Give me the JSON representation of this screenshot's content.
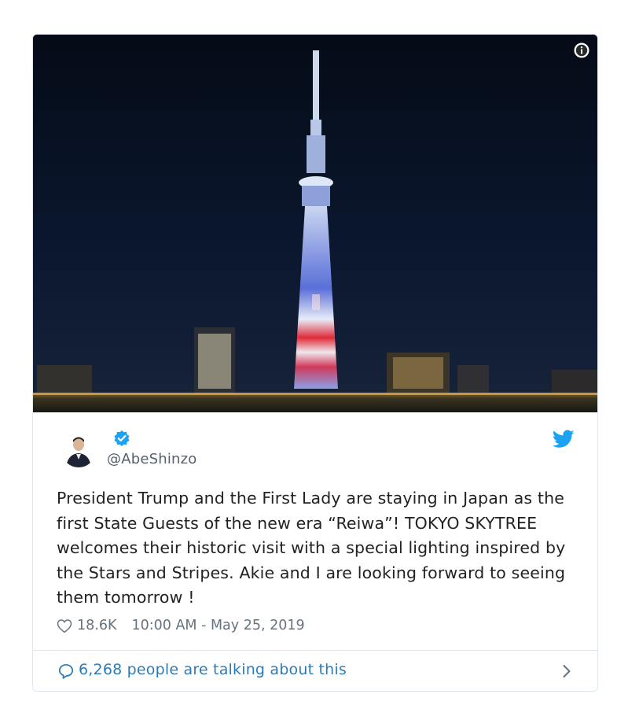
{
  "tweet": {
    "handle": "@AbeShinzo",
    "text": "President Trump and the First Lady are staying in Japan as the first State Guests of the new era “Reiwa”! TOKYO SKYTREE welcomes their historic visit with a special lighting inspired by the Stars and Stripes. Akie and I are looking forward to seeing them tomorrow !",
    "likes": "18.6K",
    "timestamp": "10:00 AM - May 25, 2019",
    "talking": "6,268 people are talking about this"
  },
  "icons": {
    "info": "info-icon",
    "verified": "verified-badge-icon",
    "brand": "twitter-bird-icon",
    "like": "heart-icon",
    "talk": "speech-bubble-icon",
    "chevron": "chevron-right-icon"
  },
  "colors": {
    "brand_blue": "#1da1f2",
    "link_blue": "#2b7bb9",
    "text": "#222222",
    "muted": "#66727d",
    "border": "#e1e8ed"
  }
}
